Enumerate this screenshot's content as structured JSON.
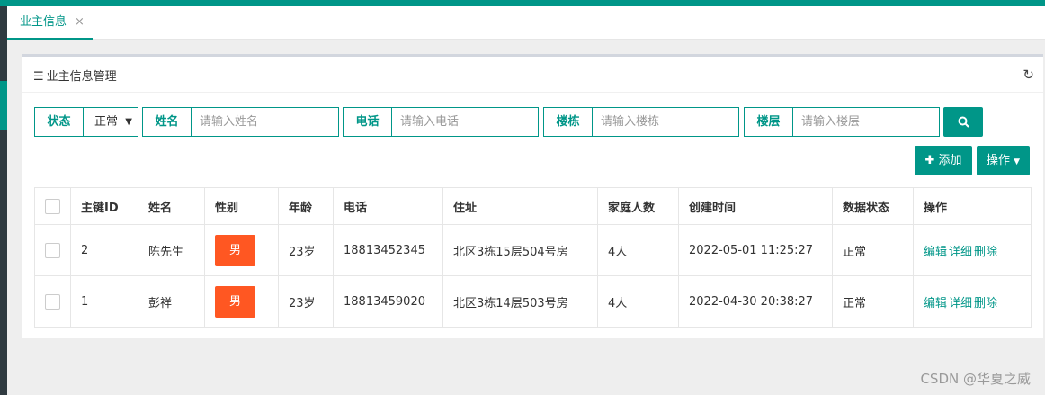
{
  "tab": {
    "label": "业主信息",
    "close": "×"
  },
  "panel": {
    "title": "业主信息管理"
  },
  "filters": {
    "status_label": "状态",
    "status_value": "正常",
    "name_label": "姓名",
    "name_placeholder": "请输入姓名",
    "phone_label": "电话",
    "phone_placeholder": "请输入电话",
    "building_label": "楼栋",
    "building_placeholder": "请输入楼栋",
    "floor_label": "楼层",
    "floor_placeholder": "请输入楼层"
  },
  "toolbar": {
    "add_label": "添加",
    "ops_label": "操作"
  },
  "table": {
    "headers": [
      "主键ID",
      "姓名",
      "性别",
      "年龄",
      "电话",
      "住址",
      "家庭人数",
      "创建时间",
      "数据状态",
      "操作"
    ],
    "rows": [
      {
        "id": "2",
        "name": "陈先生",
        "gender": "男",
        "age": "23岁",
        "phone": "18813452345",
        "address": "北区3栋15层504号房",
        "family": "4人",
        "created": "2022-05-01 11:25:27",
        "status": "正常"
      },
      {
        "id": "1",
        "name": "彭祥",
        "gender": "男",
        "age": "23岁",
        "phone": "18813459020",
        "address": "北区3栋14层503号房",
        "family": "4人",
        "created": "2022-04-30 20:38:27",
        "status": "正常"
      }
    ],
    "actions": {
      "edit": "编辑",
      "detail": "详细",
      "delete": "删除"
    }
  },
  "watermark": "CSDN @华夏之威",
  "colors": {
    "accent": "#009688",
    "gender_badge": "#ff5722",
    "sidebar": "#2f3a40"
  }
}
